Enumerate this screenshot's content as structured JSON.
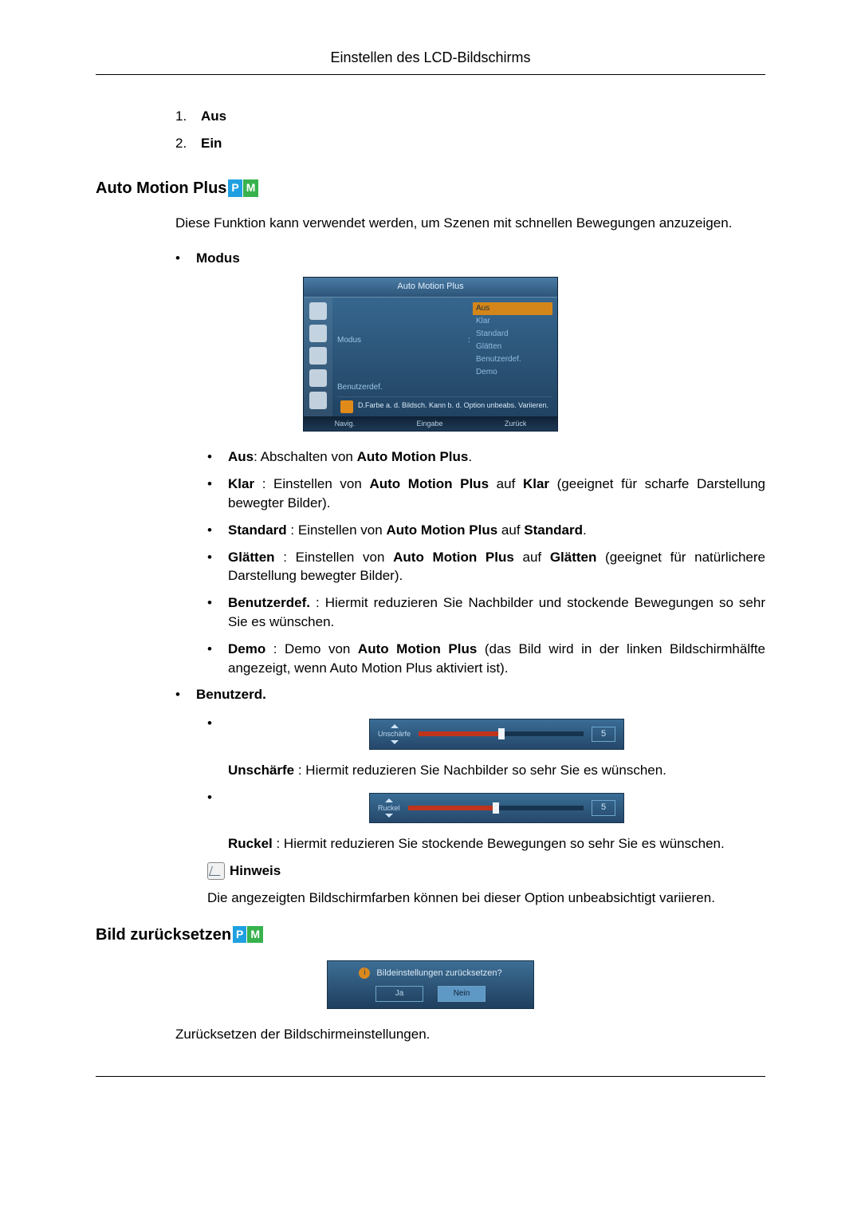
{
  "header": {
    "title": "Einstellen des LCD-Bildschirms"
  },
  "numlist": [
    {
      "num": "1.",
      "label": "Aus"
    },
    {
      "num": "2.",
      "label": "Ein"
    }
  ],
  "section1": {
    "heading": "Auto Motion Plus",
    "intro": "Diese Funktion kann verwendet werden, um Szenen mit schnellen Bewegungen anzuzeigen.",
    "modus_label": "Modus",
    "osd": {
      "title": "Auto Motion Plus",
      "row1_label": "Modus",
      "row2_label": "Benutzerdef.",
      "options": [
        "Aus",
        "Klar",
        "Standard",
        "Glätten",
        "Benutzerdef.",
        "Demo"
      ],
      "hint": "D.Farbe a. d. Bildsch. Kann b. d. Option unbeabs. Variieren.",
      "footer_nav": "Navig.",
      "footer_enter": "Eingabe",
      "footer_back": "Zurück"
    },
    "desc_aus_b": "Aus",
    "desc_aus_rest": ": Abschalten von ",
    "desc_aus_b2": "Auto Motion Plus",
    "desc_aus_end": ".",
    "desc_klar_b": "Klar",
    "desc_klar_mid1": " : Einstellen von ",
    "desc_klar_b2": "Auto Motion Plus",
    "desc_klar_mid2": " auf ",
    "desc_klar_b3": "Klar",
    "desc_klar_end": " (geeignet für scharfe Darstellung bewegter Bilder).",
    "desc_std_b": "Standard",
    "desc_std_mid1": " : Einstellen von ",
    "desc_std_b2": "Auto Motion Plus",
    "desc_std_mid2": " auf ",
    "desc_std_b3": "Standard",
    "desc_std_end": ".",
    "desc_gl_b": "Glätten",
    "desc_gl_mid1": " : Einstellen von ",
    "desc_gl_b2": "Auto Motion Plus",
    "desc_gl_mid2": " auf ",
    "desc_gl_b3": "Glätten",
    "desc_gl_end": " (geeignet für natürlichere Darstellung bewegter Bilder).",
    "desc_ben_b": "Benutzerdef.",
    "desc_ben_rest": " : Hiermit reduzieren Sie Nachbilder und stockende Bewegungen so sehr Sie es wünschen.",
    "desc_demo_b": "Demo",
    "desc_demo_mid1": " : Demo von ",
    "desc_demo_b2": "Auto Motion Plus",
    "desc_demo_end": " (das Bild wird in der linken Bildschirmhälfte angezeigt, wenn Auto Motion Plus aktiviert ist).",
    "benutzerd_label": "Benutzerd.",
    "slider1_label": "Unschärfe",
    "slider1_val": "5",
    "slider1_desc_b": "Unschärfe",
    "slider1_desc_rest": " : Hiermit reduzieren Sie Nachbilder so sehr Sie es wünschen.",
    "slider2_label": "Ruckel",
    "slider2_val": "5",
    "slider2_desc_b": "Ruckel",
    "slider2_desc_rest": " : Hiermit reduzieren Sie stockende Bewegungen so sehr Sie es wünschen.",
    "hinweis_label": "Hinweis",
    "hinweis_text": "Die angezeigten Bildschirmfarben können bei dieser Option unbeabsichtigt variieren."
  },
  "section2": {
    "heading": "Bild zurücksetzen",
    "confirm_text": "Bildeinstellungen zurücksetzen?",
    "btn_ja": "Ja",
    "btn_nein": "Nein",
    "desc": "Zurücksetzen der Bildschirmeinstellungen."
  }
}
